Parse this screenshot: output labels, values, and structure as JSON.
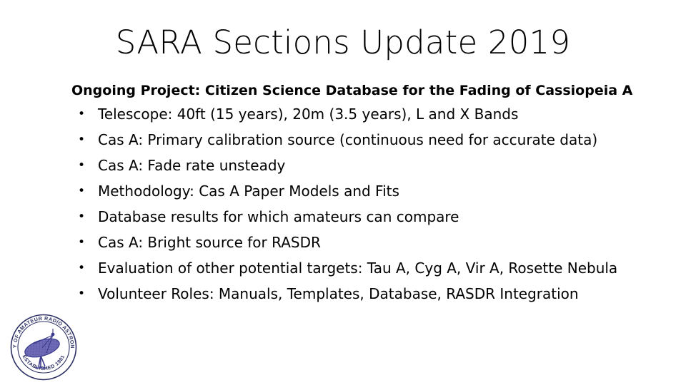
{
  "slide": {
    "title": "SARA Sections Update 2019",
    "lead_line": "Ongoing Project: Citizen Science Database for the Fading of Cassiopeia A",
    "bullet_marker": "•",
    "bullets": [
      {
        "text": "Telescope: 40ft (15 years), 20m (3.5 years), L and X Bands"
      },
      {
        "text": "Cas A: Primary calibration source (continuous need for accurate data)"
      },
      {
        "text": "Cas A: Fade rate unsteady"
      },
      {
        "text": "Methodology: Cas A Paper Models and Fits"
      },
      {
        "text": "Database results for which amateurs can compare"
      },
      {
        "text": "Cas A: Bright source for RASDR"
      },
      {
        "text": "Evaluation of other potential targets: Tau A, Cyg A, Vir A, Rosette Nebula"
      },
      {
        "text": "Volunteer Roles: Manuals, Templates, Database, RASDR Integration"
      }
    ]
  },
  "logo": {
    "name": "sara-seal-logo",
    "arc_text": "SOCIETY OF AMATEUR RADIO ASTRONOMERS",
    "bottom_text": "ESTABLISHED 1981",
    "ring_color": "#2b2f63",
    "dish_color": "#6f6bb6",
    "dish_outline_color": "#3a3a8c"
  },
  "colors": {
    "background": "#ffffff",
    "text": "#000000"
  }
}
